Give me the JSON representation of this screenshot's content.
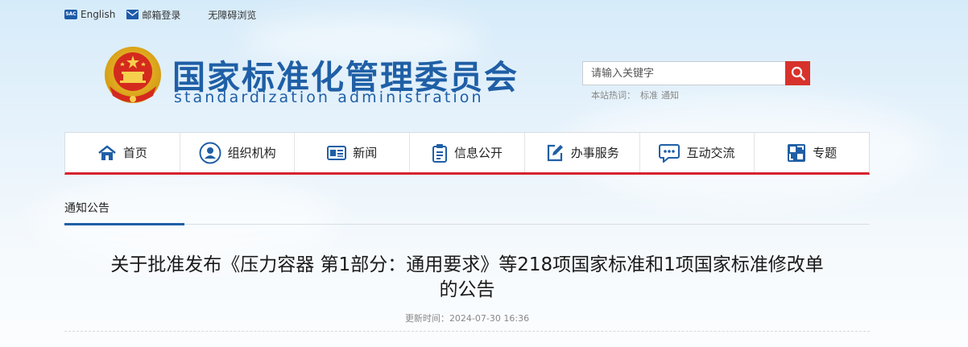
{
  "top_links": {
    "english": "English",
    "email": "邮箱登录",
    "accessibility": "无障碍浏览",
    "sac_logo_text": "SAC"
  },
  "header": {
    "title_cn": "国家标准化管理委员会",
    "title_en": "standardization administration"
  },
  "search": {
    "placeholder": "请输入关键字",
    "hot_label": "本站热词：",
    "hot_words": [
      "标准",
      "通知"
    ]
  },
  "nav": {
    "items": [
      {
        "label": "首页",
        "icon": "home-icon"
      },
      {
        "label": "组织机构",
        "icon": "organization-icon"
      },
      {
        "label": "新闻",
        "icon": "news-icon"
      },
      {
        "label": "信息公开",
        "icon": "clipboard-icon"
      },
      {
        "label": "办事服务",
        "icon": "edit-icon"
      },
      {
        "label": "互动交流",
        "icon": "chat-icon"
      },
      {
        "label": "专题",
        "icon": "topics-icon"
      }
    ]
  },
  "breadcrumb": {
    "current": "通知公告"
  },
  "article": {
    "title_line1": "关于批准发布《压力容器 第1部分：通用要求》等218项国家标准和1项国家标准修改单",
    "title_line2": "的公告",
    "updated_label": "更新时间：",
    "updated_value": "2024-07-30 16:36"
  },
  "colors": {
    "brand_blue": "#1f5fa6",
    "accent_red": "#d7232f",
    "search_red": "#d7322b"
  }
}
